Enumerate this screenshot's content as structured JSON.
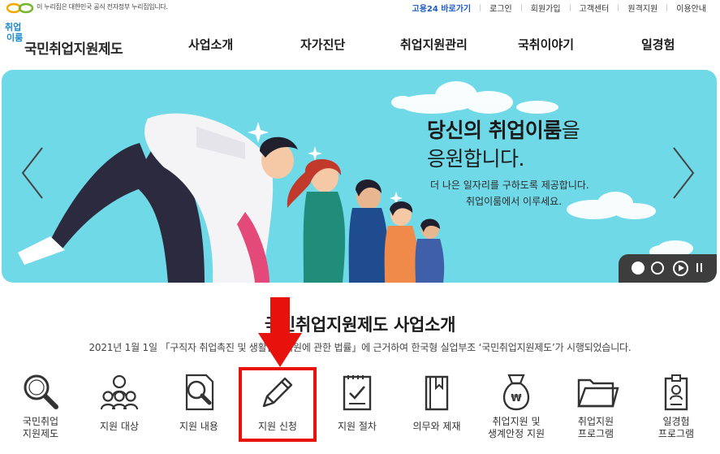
{
  "topbar": {
    "gov_notice": "이 누리집은 대한민국 공식 전자정부 누리집입니다.",
    "links": [
      "고용24 바로가기",
      "로그인",
      "회원가입",
      "고객센터",
      "원격지원",
      "이용안내"
    ]
  },
  "header": {
    "brand_mini": "취업",
    "brand_mini2": "이룸",
    "brand_name": "국민취업지원제도",
    "nav": [
      "사업소개",
      "자가진단",
      "취업지원관리",
      "국취이야기",
      "일경험"
    ]
  },
  "hero": {
    "headline_bold": "당신의 취업이룸",
    "headline_rest": "을",
    "headline_line2": "응원합니다.",
    "sub_line1": "더 나은 일자리를 구하도록 제공합니다.",
    "sub_line2": "취업이룸에서 이루세요.",
    "slide_current": 1,
    "slide_total": 2
  },
  "section": {
    "title": "국민취업지원제도 사업소개",
    "description": "2021년 1월 1일 「구직자 취업촉진 및 생활안정지원에 관한 법률」에 근거하여 한국형 실업부조 ‘국민취업지원제도’가 시행되었습니다.",
    "items": [
      {
        "label": "국민취업\n지원제도",
        "icon": "magnifier-icon"
      },
      {
        "label": "지원 대상",
        "icon": "people-group-icon"
      },
      {
        "label": "지원 내용",
        "icon": "document-search-icon"
      },
      {
        "label": "지원 신청",
        "icon": "pencil-icon"
      },
      {
        "label": "지원 절차",
        "icon": "checklist-icon"
      },
      {
        "label": "의무와 제재",
        "icon": "book-icon"
      },
      {
        "label": "취업지원 및\n생계안정 지원",
        "icon": "money-bag-icon"
      },
      {
        "label": "취업지원\n프로그램",
        "icon": "folder-icon"
      },
      {
        "label": "일경험\n프로그램",
        "icon": "id-badge-icon"
      }
    ],
    "highlighted_item": "지원 신청"
  },
  "colors": {
    "accent_blue": "#1e5cc4",
    "hero_bg": "#6fd9e8",
    "highlight_red": "#e8120c"
  }
}
